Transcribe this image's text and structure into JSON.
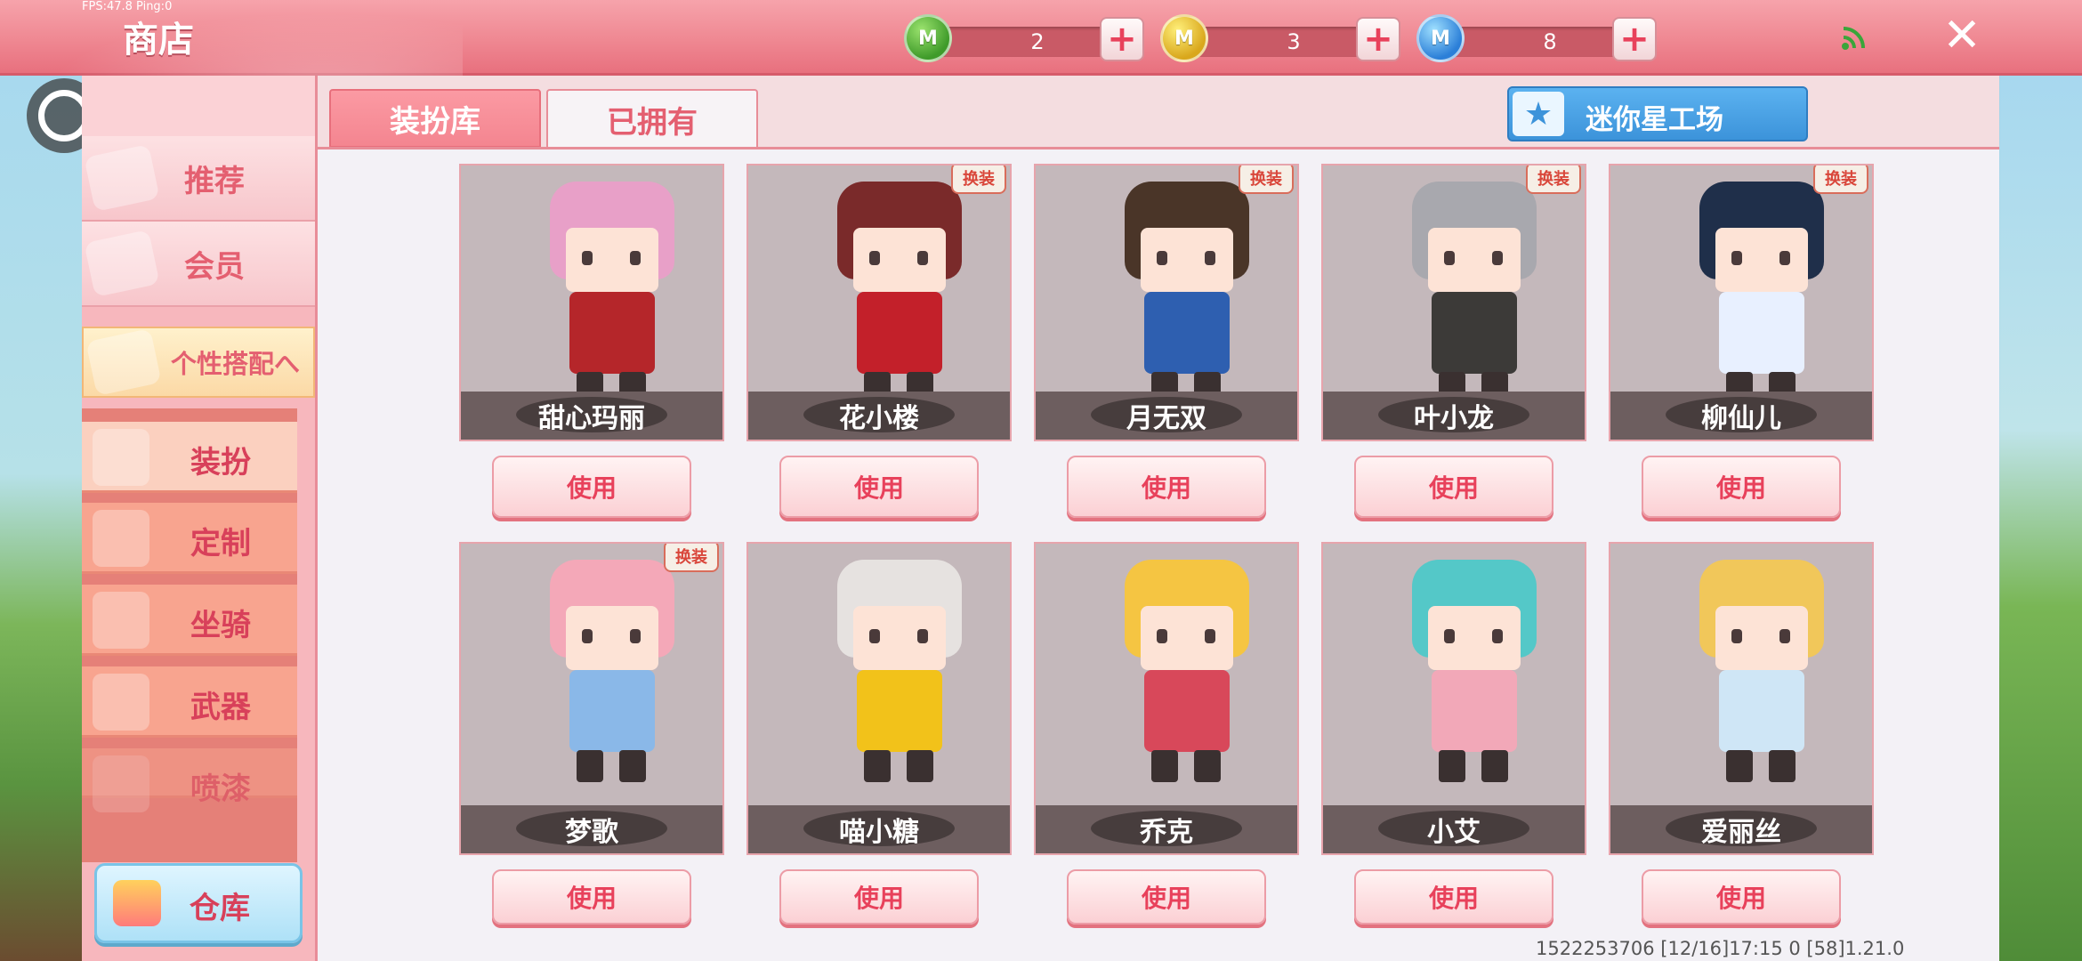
{
  "header": {
    "fps": "FPS:47.8  Ping:0",
    "title": "商店",
    "currencies": [
      {
        "icon": "green-m-coin-icon",
        "value": "2",
        "color": "#3f9b2a"
      },
      {
        "icon": "gold-m-coin-icon",
        "value": "3",
        "color": "#d9a71c"
      },
      {
        "icon": "blue-m-coin-icon",
        "value": "8",
        "color": "#2b7fd8"
      }
    ],
    "plus_label": "+",
    "close_label": "✕"
  },
  "sidebar": {
    "items": [
      {
        "label": "推荐"
      },
      {
        "label": "会员"
      },
      {
        "label": "个性搭配へ"
      }
    ],
    "sub_items": [
      {
        "label": "装扮"
      },
      {
        "label": "定制"
      },
      {
        "label": "坐骑"
      },
      {
        "label": "武器"
      },
      {
        "label": "喷漆"
      }
    ],
    "warehouse_label": "仓库"
  },
  "tabs": {
    "wardrobe": "装扮库",
    "owned": "已拥有"
  },
  "workshop_label": "迷你星工场",
  "skins": [
    {
      "name": "甜心玛丽",
      "badge": "",
      "hair": "#e8a0c8",
      "outfit": "#b5262a",
      "use": "使用"
    },
    {
      "name": "花小楼",
      "badge": "换装",
      "hair": "#7a2a2a",
      "outfit": "#c3202a",
      "use": "使用"
    },
    {
      "name": "月无双",
      "badge": "换装",
      "hair": "#4a3528",
      "outfit": "#2e5fb0",
      "use": "使用"
    },
    {
      "name": "叶小龙",
      "badge": "换装",
      "hair": "#a8a8ae",
      "outfit": "#3c3a38",
      "use": "使用"
    },
    {
      "name": "柳仙儿",
      "badge": "换装",
      "hair": "#1f2f4a",
      "outfit": "#e8f0ff",
      "use": "使用"
    },
    {
      "name": "梦歌",
      "badge": "换装",
      "hair": "#f4a8b8",
      "outfit": "#8ab8e8",
      "use": "使用"
    },
    {
      "name": "喵小糖",
      "badge": "",
      "hair": "#e6e2e0",
      "outfit": "#f2c21a",
      "use": "使用"
    },
    {
      "name": "乔克",
      "badge": "",
      "hair": "#f5c542",
      "outfit": "#d8485a",
      "use": "使用"
    },
    {
      "name": "小艾",
      "badge": "",
      "hair": "#54c8c8",
      "outfit": "#f2a8b8",
      "use": "使用"
    },
    {
      "name": "爱丽丝",
      "badge": "",
      "hair": "#f1c75a",
      "outfit": "#cfe6f6",
      "use": "使用"
    }
  ],
  "footer": "1522253706   [12/16]17:15 0     [58]1.21.0"
}
